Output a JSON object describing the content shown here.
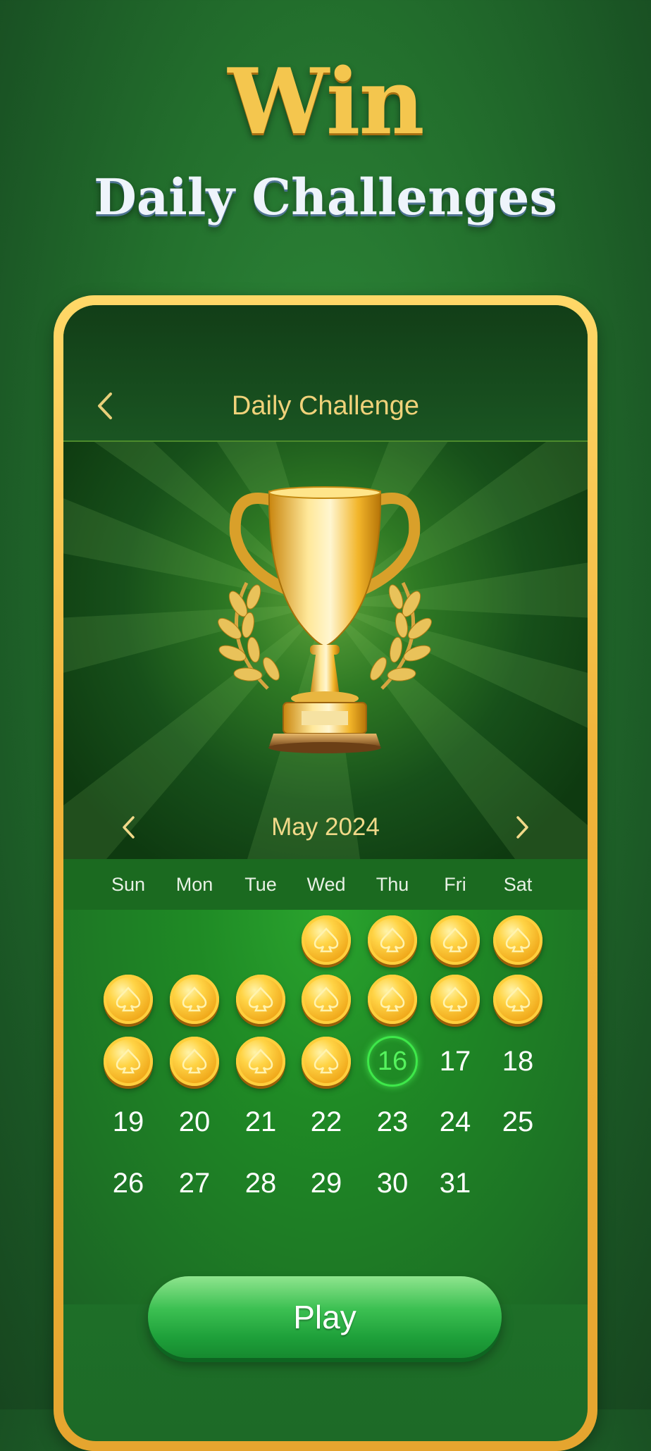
{
  "hero": {
    "title": "Win",
    "subtitle": "Daily Challenges"
  },
  "header": {
    "title": "Daily Challenge",
    "back_icon": "chevron-left-icon"
  },
  "calendar": {
    "month_label": "May 2024",
    "prev_icon": "chevron-left-icon",
    "next_icon": "chevron-right-icon",
    "weekdays": [
      "Sun",
      "Mon",
      "Tue",
      "Wed",
      "Thu",
      "Fri",
      "Sat"
    ],
    "completed_days": [
      1,
      2,
      3,
      4,
      5,
      6,
      7,
      8,
      9,
      10,
      11,
      12,
      13,
      14,
      15
    ],
    "today": "16",
    "days": {
      "d17": "17",
      "d18": "18",
      "d19": "19",
      "d20": "20",
      "d21": "21",
      "d22": "22",
      "d23": "23",
      "d24": "24",
      "d25": "25",
      "d26": "26",
      "d27": "27",
      "d28": "28",
      "d29": "29",
      "d30": "30",
      "d31": "31"
    },
    "completed_icon": "spade-coin-icon"
  },
  "actions": {
    "play_label": "Play"
  },
  "colors": {
    "gold": "#f4c64e",
    "today_green": "#55f25d",
    "play_green": "#1ea03a"
  }
}
